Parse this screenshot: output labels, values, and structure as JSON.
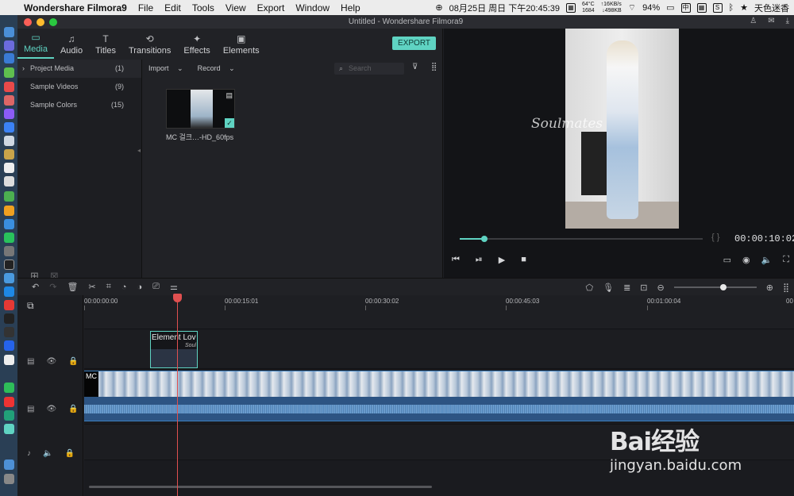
{
  "menubar": {
    "app_name": "Wondershare Filmora9",
    "menus": [
      "File",
      "Edit",
      "Tools",
      "View",
      "Export",
      "Window",
      "Help"
    ],
    "datetime": "08月25日 周日 下午20:45:39",
    "temp": "64°C",
    "cpu": "1684",
    "net_up": "↑16KB/s",
    "net_down": "↓498KB",
    "battery": "94%",
    "user": "天色迷香"
  },
  "window": {
    "title": "Untitled - Wondershare Filmora9"
  },
  "tabs": [
    {
      "label": "Media",
      "icon": "folder-icon"
    },
    {
      "label": "Audio",
      "icon": "music-note-icon"
    },
    {
      "label": "Titles",
      "icon": "text-icon"
    },
    {
      "label": "Transitions",
      "icon": "transition-icon"
    },
    {
      "label": "Effects",
      "icon": "effects-icon"
    },
    {
      "label": "Elements",
      "icon": "image-icon"
    }
  ],
  "export_label": "EXPORT",
  "library": [
    {
      "label": "Project Media",
      "count": "(1)"
    },
    {
      "label": "Sample Videos",
      "count": "(9)"
    },
    {
      "label": "Sample Colors",
      "count": "(15)"
    }
  ],
  "bin": {
    "import_label": "Import",
    "record_label": "Record",
    "search_placeholder": "Search",
    "clip_name": "MC 걸크…-HD_60fps"
  },
  "preview": {
    "watermark": "Soulmates",
    "timecode": "00:00:10:02",
    "progress": 0.1
  },
  "timeline": {
    "ruler": [
      "00:00:00:00",
      "00:00:15:01",
      "00:00:30:02",
      "00:00:45:03",
      "00:01:00:04",
      "00"
    ],
    "element_clip_label": "Element Lov",
    "element_clip_sub": "Soul",
    "video_clip_label": "MC",
    "zoom_level": 0.6
  },
  "baidu": {
    "brand": "Bai经验",
    "url": "jingyan.baidu.com"
  },
  "colors": {
    "accent": "#5fd3c2",
    "playhead": "#e05050",
    "audio": "#2d5483"
  }
}
